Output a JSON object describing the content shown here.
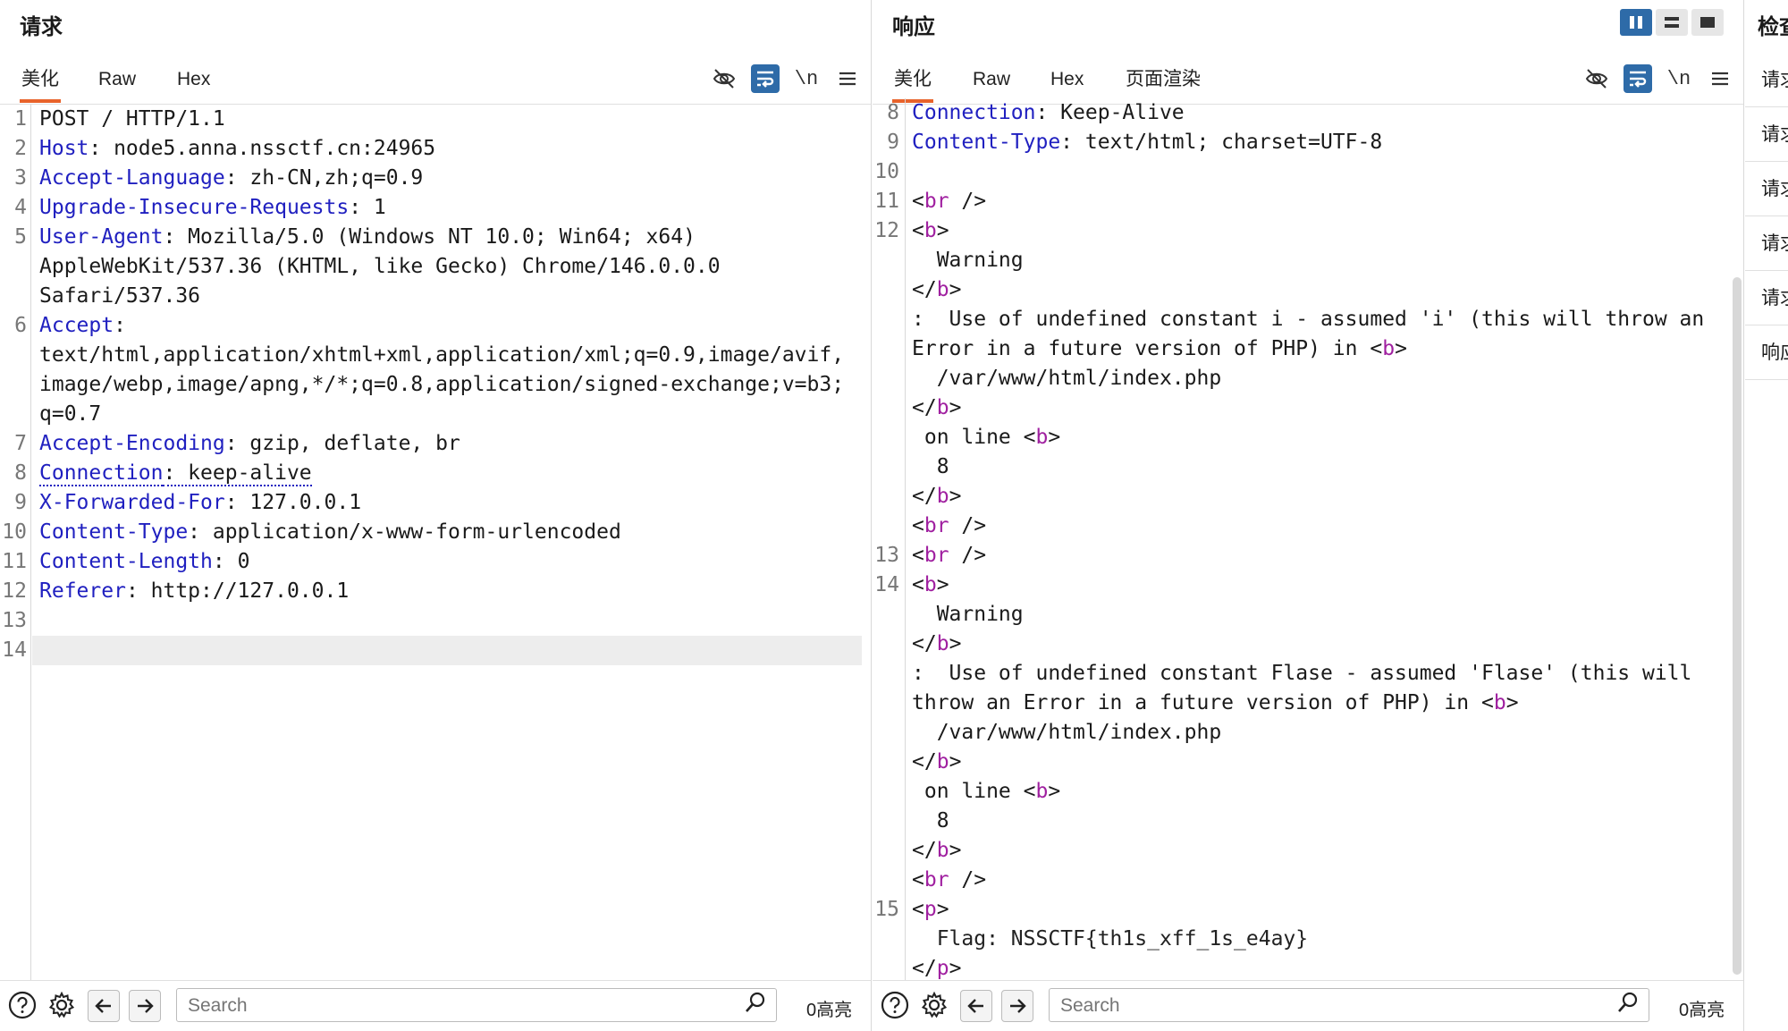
{
  "request": {
    "title": "请求",
    "tabs": [
      "美化",
      "Raw",
      "Hex"
    ],
    "newline_label": "\\n",
    "lines": [
      {
        "n": "1",
        "parts": [
          {
            "t": "POST / HTTP/1.1",
            "c": ""
          }
        ]
      },
      {
        "n": "2",
        "parts": [
          {
            "t": "Host",
            "c": "k"
          },
          {
            "t": ": node5.anna.nssctf.cn:24965",
            "c": ""
          }
        ]
      },
      {
        "n": "3",
        "parts": [
          {
            "t": "Accept-Language",
            "c": "k"
          },
          {
            "t": ": zh-CN,zh;q=0.9",
            "c": ""
          }
        ]
      },
      {
        "n": "4",
        "parts": [
          {
            "t": "Upgrade-Insecure-Requests",
            "c": "k"
          },
          {
            "t": ": 1",
            "c": ""
          }
        ]
      },
      {
        "n": "5",
        "parts": [
          {
            "t": "User-Agent",
            "c": "k"
          },
          {
            "t": ": Mozilla/5.0 (Windows NT 10.0; Win64; x64)",
            "c": ""
          }
        ]
      },
      {
        "n": "",
        "parts": [
          {
            "t": "AppleWebKit/537.36 (KHTML, like Gecko) Chrome/146.0.0.0",
            "c": ""
          }
        ]
      },
      {
        "n": "",
        "parts": [
          {
            "t": "Safari/537.36",
            "c": ""
          }
        ]
      },
      {
        "n": "6",
        "parts": [
          {
            "t": "Accept",
            "c": "k"
          },
          {
            "t": ":",
            "c": ""
          }
        ]
      },
      {
        "n": "",
        "parts": [
          {
            "t": "text/html,application/xhtml+xml,application/xml;q=0.9,image/avif,",
            "c": ""
          }
        ]
      },
      {
        "n": "",
        "parts": [
          {
            "t": "image/webp,image/apng,*/*;q=0.8,application/signed-exchange;v=b3;",
            "c": ""
          }
        ]
      },
      {
        "n": "",
        "parts": [
          {
            "t": "q=0.7",
            "c": ""
          }
        ]
      },
      {
        "n": "7",
        "parts": [
          {
            "t": "Accept-Encoding",
            "c": "k"
          },
          {
            "t": ": gzip, deflate, br",
            "c": ""
          }
        ]
      },
      {
        "n": "8",
        "parts": [
          {
            "t": "Connection",
            "c": "k dotted"
          },
          {
            "t": ": keep-alive",
            "c": "dotted"
          }
        ]
      },
      {
        "n": "9",
        "parts": [
          {
            "t": "X-Forwarded-For",
            "c": "k"
          },
          {
            "t": ": 127.0.0.1",
            "c": ""
          }
        ]
      },
      {
        "n": "10",
        "parts": [
          {
            "t": "Content-Type",
            "c": "k"
          },
          {
            "t": ": application/x-www-form-urlencoded",
            "c": ""
          }
        ]
      },
      {
        "n": "11",
        "parts": [
          {
            "t": "Content-Length",
            "c": "k"
          },
          {
            "t": ": 0",
            "c": ""
          }
        ]
      },
      {
        "n": "12",
        "parts": [
          {
            "t": "Referer",
            "c": "k"
          },
          {
            "t": ": http://127.0.0.1",
            "c": ""
          }
        ]
      },
      {
        "n": "13",
        "parts": []
      },
      {
        "n": "14",
        "parts": [],
        "highlight": true
      }
    ],
    "search_placeholder": "Search",
    "hits": "0高亮"
  },
  "response": {
    "title": "响应",
    "tabs": [
      "美化",
      "Raw",
      "Hex",
      "页面渲染"
    ],
    "newline_label": "\\n",
    "lines": [
      {
        "n": "8",
        "parts": [
          {
            "t": "Connection",
            "c": "k"
          },
          {
            "t": ": Keep-Alive",
            "c": ""
          }
        ]
      },
      {
        "n": "9",
        "parts": [
          {
            "t": "Content-Type",
            "c": "k"
          },
          {
            "t": ": text/html; charset=UTF-8",
            "c": ""
          }
        ]
      },
      {
        "n": "10",
        "parts": []
      },
      {
        "n": "11",
        "parts": [
          {
            "t": "<",
            "c": ""
          },
          {
            "t": "br",
            "c": "tag"
          },
          {
            "t": " />",
            "c": ""
          }
        ]
      },
      {
        "n": "12",
        "parts": [
          {
            "t": "<",
            "c": ""
          },
          {
            "t": "b",
            "c": "tag"
          },
          {
            "t": ">",
            "c": ""
          }
        ]
      },
      {
        "n": "",
        "parts": [
          {
            "t": "  Warning",
            "c": ""
          }
        ]
      },
      {
        "n": "",
        "parts": [
          {
            "t": "</",
            "c": ""
          },
          {
            "t": "b",
            "c": "tag"
          },
          {
            "t": ">",
            "c": ""
          }
        ]
      },
      {
        "n": "",
        "parts": [
          {
            "t": ":  Use of undefined constant i - assumed 'i' (this will throw an",
            "c": ""
          }
        ]
      },
      {
        "n": "",
        "parts": [
          {
            "t": "Error in a future version of PHP) in ",
            "c": ""
          },
          {
            "t": "<",
            "c": ""
          },
          {
            "t": "b",
            "c": "tag"
          },
          {
            "t": ">",
            "c": ""
          }
        ]
      },
      {
        "n": "",
        "parts": [
          {
            "t": "  /var/www/html/index.php",
            "c": ""
          }
        ]
      },
      {
        "n": "",
        "parts": [
          {
            "t": "</",
            "c": ""
          },
          {
            "t": "b",
            "c": "tag"
          },
          {
            "t": ">",
            "c": ""
          }
        ]
      },
      {
        "n": "",
        "parts": [
          {
            "t": " on line ",
            "c": ""
          },
          {
            "t": "<",
            "c": ""
          },
          {
            "t": "b",
            "c": "tag"
          },
          {
            "t": ">",
            "c": ""
          }
        ]
      },
      {
        "n": "",
        "parts": [
          {
            "t": "  8",
            "c": ""
          }
        ]
      },
      {
        "n": "",
        "parts": [
          {
            "t": "</",
            "c": ""
          },
          {
            "t": "b",
            "c": "tag"
          },
          {
            "t": ">",
            "c": ""
          }
        ]
      },
      {
        "n": "",
        "parts": [
          {
            "t": "<",
            "c": ""
          },
          {
            "t": "br",
            "c": "tag"
          },
          {
            "t": " />",
            "c": ""
          }
        ]
      },
      {
        "n": "13",
        "parts": [
          {
            "t": "<",
            "c": ""
          },
          {
            "t": "br",
            "c": "tag"
          },
          {
            "t": " />",
            "c": ""
          }
        ]
      },
      {
        "n": "14",
        "parts": [
          {
            "t": "<",
            "c": ""
          },
          {
            "t": "b",
            "c": "tag"
          },
          {
            "t": ">",
            "c": ""
          }
        ]
      },
      {
        "n": "",
        "parts": [
          {
            "t": "  Warning",
            "c": ""
          }
        ]
      },
      {
        "n": "",
        "parts": [
          {
            "t": "</",
            "c": ""
          },
          {
            "t": "b",
            "c": "tag"
          },
          {
            "t": ">",
            "c": ""
          }
        ]
      },
      {
        "n": "",
        "parts": [
          {
            "t": ":  Use of undefined constant Flase - assumed 'Flase' (this will",
            "c": ""
          }
        ]
      },
      {
        "n": "",
        "parts": [
          {
            "t": "throw an Error in a future version of PHP) in ",
            "c": ""
          },
          {
            "t": "<",
            "c": ""
          },
          {
            "t": "b",
            "c": "tag"
          },
          {
            "t": ">",
            "c": ""
          }
        ]
      },
      {
        "n": "",
        "parts": [
          {
            "t": "  /var/www/html/index.php",
            "c": ""
          }
        ]
      },
      {
        "n": "",
        "parts": [
          {
            "t": "</",
            "c": ""
          },
          {
            "t": "b",
            "c": "tag"
          },
          {
            "t": ">",
            "c": ""
          }
        ]
      },
      {
        "n": "",
        "parts": [
          {
            "t": " on line ",
            "c": ""
          },
          {
            "t": "<",
            "c": ""
          },
          {
            "t": "b",
            "c": "tag"
          },
          {
            "t": ">",
            "c": ""
          }
        ]
      },
      {
        "n": "",
        "parts": [
          {
            "t": "  8",
            "c": ""
          }
        ]
      },
      {
        "n": "",
        "parts": [
          {
            "t": "</",
            "c": ""
          },
          {
            "t": "b",
            "c": "tag"
          },
          {
            "t": ">",
            "c": ""
          }
        ]
      },
      {
        "n": "",
        "parts": [
          {
            "t": "<",
            "c": ""
          },
          {
            "t": "br",
            "c": "tag"
          },
          {
            "t": " />",
            "c": ""
          }
        ]
      },
      {
        "n": "15",
        "parts": [
          {
            "t": "<",
            "c": ""
          },
          {
            "t": "p",
            "c": "tag"
          },
          {
            "t": ">",
            "c": ""
          }
        ]
      },
      {
        "n": "",
        "parts": [
          {
            "t": "  Flag: NSSCTF{th1s_xff_1s_e4ay}",
            "c": "flag"
          }
        ]
      },
      {
        "n": "",
        "parts": [
          {
            "t": "</",
            "c": ""
          },
          {
            "t": "p",
            "c": "tag"
          },
          {
            "t": ">",
            "c": ""
          }
        ]
      }
    ],
    "search_placeholder": "Search",
    "hits": "0高亮"
  },
  "inspector": {
    "title": "检查",
    "items": [
      "请求",
      "请求",
      "请求",
      "请求",
      "请求",
      "响应"
    ]
  },
  "colors": {
    "accent": "#e8632b",
    "button_blue": "#2e6ba8",
    "header_key": "#2020c0",
    "tag": "#a020a0"
  },
  "icons": [
    "hide-icon",
    "wrap-icon",
    "newline-icon",
    "menu-icon",
    "help-icon",
    "settings-icon",
    "arrow-left-icon",
    "arrow-right-icon",
    "search-icon"
  ]
}
